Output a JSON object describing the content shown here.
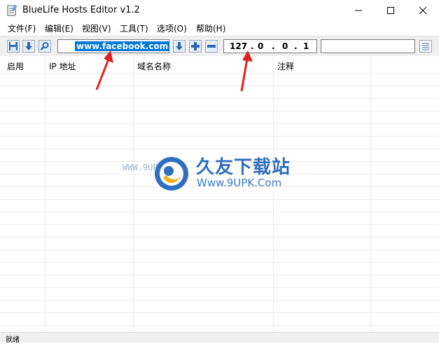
{
  "window": {
    "title": "BlueLife Hosts Editor v1.2"
  },
  "menu": [
    {
      "label": "文件(F)"
    },
    {
      "label": "编辑(E)"
    },
    {
      "label": "视图(V)"
    },
    {
      "label": "工具(T)"
    },
    {
      "label": "选项(O)"
    },
    {
      "label": "帮助(H)"
    }
  ],
  "toolbar": {
    "domain_value": "www.facebook.com",
    "ip": [
      "127",
      ".",
      "0",
      ".",
      "0",
      ".",
      "1"
    ],
    "comment_value": ""
  },
  "columns": [
    {
      "label": "启用"
    },
    {
      "label": "IP 地址"
    },
    {
      "label": "域名名称"
    },
    {
      "label": "注释"
    }
  ],
  "status": {
    "text": "就绪"
  },
  "watermark": {
    "title": "久友下载站",
    "url": "Www.9UPK.Com",
    "small": "WWW.9UPK.COM"
  },
  "colors": {
    "accent": "#0078d7",
    "arrow": "#e0201c"
  }
}
